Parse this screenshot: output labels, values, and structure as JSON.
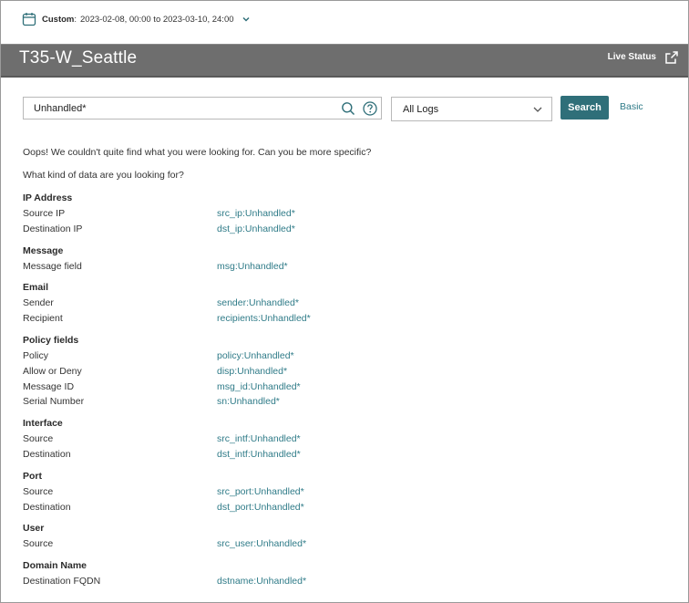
{
  "date_filter": {
    "label": "Custom",
    "separator": ":",
    "range": "2023-02-08, 00:00 to 2023-03-10, 24:00"
  },
  "header": {
    "title": "T35-W_Seattle",
    "live_status_label": "Live Status"
  },
  "search": {
    "query": "Unhandled*",
    "log_type": "All Logs",
    "search_button_label": "Search",
    "basic_link_label": "Basic"
  },
  "messages": {
    "not_found": "Oops! We couldn't quite find what you were looking for. Can you be more specific?",
    "prompt": "What kind of data are you looking for?"
  },
  "groups": [
    {
      "title": "IP Address",
      "fields": [
        {
          "label": "Source IP",
          "query": "src_ip:Unhandled*"
        },
        {
          "label": "Destination IP",
          "query": "dst_ip:Unhandled*"
        }
      ]
    },
    {
      "title": "Message",
      "fields": [
        {
          "label": "Message field",
          "query": "msg:Unhandled*"
        }
      ]
    },
    {
      "title": "Email",
      "fields": [
        {
          "label": "Sender",
          "query": "sender:Unhandled*"
        },
        {
          "label": "Recipient",
          "query": "recipients:Unhandled*"
        }
      ]
    },
    {
      "title": "Policy fields",
      "fields": [
        {
          "label": "Policy",
          "query": "policy:Unhandled*"
        },
        {
          "label": "Allow or Deny",
          "query": "disp:Unhandled*"
        },
        {
          "label": "Message ID",
          "query": "msg_id:Unhandled*"
        },
        {
          "label": "Serial Number",
          "query": "sn:Unhandled*"
        }
      ]
    },
    {
      "title": "Interface",
      "fields": [
        {
          "label": "Source",
          "query": "src_intf:Unhandled*"
        },
        {
          "label": "Destination",
          "query": "dst_intf:Unhandled*"
        }
      ]
    },
    {
      "title": "Port",
      "fields": [
        {
          "label": "Source",
          "query": "src_port:Unhandled*"
        },
        {
          "label": "Destination",
          "query": "dst_port:Unhandled*"
        }
      ]
    },
    {
      "title": "User",
      "fields": [
        {
          "label": "Source",
          "query": "src_user:Unhandled*"
        }
      ]
    },
    {
      "title": "Domain Name",
      "fields": [
        {
          "label": "Destination FQDN",
          "query": "dstname:Unhandled*"
        }
      ]
    }
  ],
  "icons": {
    "calendar": "calendar-icon",
    "date_dropdown": "chevron-down-icon",
    "external_link": "external-link-icon",
    "search": "search-icon",
    "help": "help-icon",
    "log_dropdown": "chevron-down-icon"
  },
  "colors": {
    "accent": "#2f6f79",
    "link": "#2f7b88",
    "header_bg": "#6e6e6e"
  }
}
